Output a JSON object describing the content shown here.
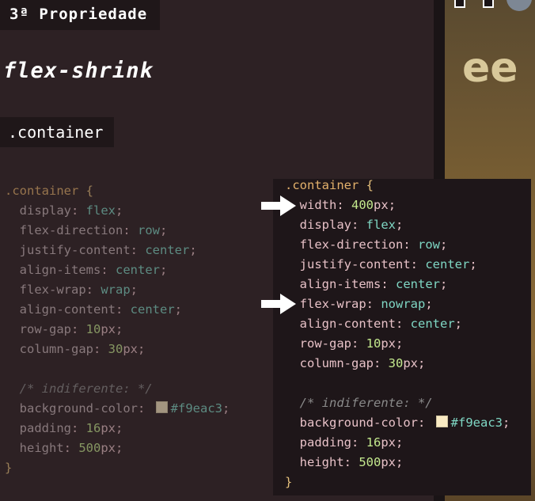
{
  "slide": {
    "title": "3ª Propriedade",
    "heading": "flex-shrink",
    "selector_label": ".container"
  },
  "left_code": {
    "selector": ".container",
    "open_brace": "{",
    "close_brace": "}",
    "lines": [
      {
        "prop": "display",
        "value": "flex"
      },
      {
        "prop": "flex-direction",
        "value": "row"
      },
      {
        "prop": "justify-content",
        "value": "center"
      },
      {
        "prop": "align-items",
        "value": "center"
      },
      {
        "prop": "flex-wrap",
        "value": "wrap"
      },
      {
        "prop": "align-content",
        "value": "center"
      },
      {
        "prop": "row-gap",
        "num": "10",
        "unit": "px"
      },
      {
        "prop": "column-gap",
        "num": "30",
        "unit": "px"
      }
    ],
    "comment": "/* indiferente: */",
    "extra_lines": [
      {
        "prop": "background-color",
        "color": "#f9eac3",
        "value": "#f9eac3"
      },
      {
        "prop": "padding",
        "num": "16",
        "unit": "px"
      },
      {
        "prop": "height",
        "num": "500",
        "unit": "px"
      }
    ]
  },
  "right_code": {
    "selector": ".container",
    "open_brace": "{",
    "close_brace": "}",
    "lines": [
      {
        "prop": "width",
        "num": "400",
        "unit": "px",
        "highlight": true
      },
      {
        "prop": "display",
        "value": "flex"
      },
      {
        "prop": "flex-direction",
        "value": "row"
      },
      {
        "prop": "justify-content",
        "value": "center"
      },
      {
        "prop": "align-items",
        "value": "center"
      },
      {
        "prop": "flex-wrap",
        "value": "nowrap",
        "highlight": true
      },
      {
        "prop": "align-content",
        "value": "center"
      },
      {
        "prop": "row-gap",
        "num": "10",
        "unit": "px"
      },
      {
        "prop": "column-gap",
        "num": "30",
        "unit": "px"
      }
    ],
    "comment": "/* indiferente: */",
    "extra_lines": [
      {
        "prop": "background-color",
        "color": "#f9eac3",
        "value": "#f9eac3"
      },
      {
        "prop": "padding",
        "num": "16",
        "unit": "px"
      },
      {
        "prop": "height",
        "num": "500",
        "unit": "px"
      }
    ]
  },
  "icons": [
    "right-arrow-icon",
    "right-arrow-icon"
  ]
}
